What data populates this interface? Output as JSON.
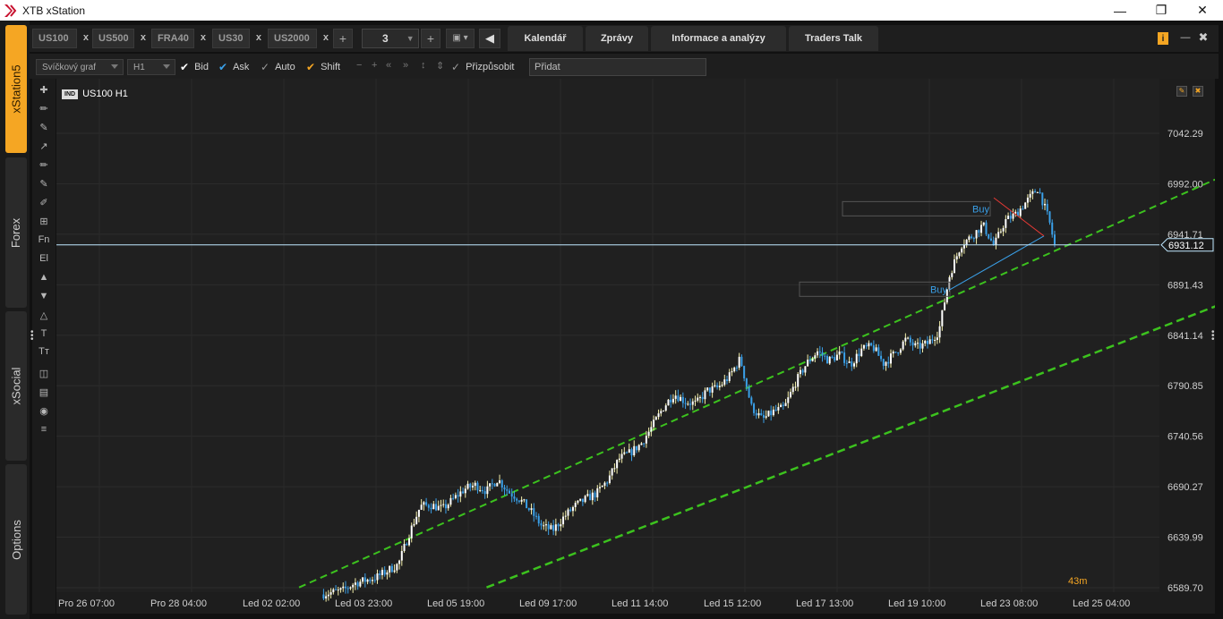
{
  "window": {
    "title": "XTB xStation"
  },
  "side_tabs": [
    "xStation5",
    "Forex",
    "xSocial",
    "Options"
  ],
  "instrument_tabs": [
    "US100",
    "US500",
    "FRA40",
    "US30",
    "US2000"
  ],
  "close_glyph": "x",
  "layout_count": "3",
  "nav_tabs": [
    "Kalendář",
    "Zprávy",
    "Informace a analýzy",
    "Traders Talk"
  ],
  "toolbar": {
    "chart_type": "Svíčkový graf",
    "timeframe": "H1",
    "checks": [
      {
        "label": "Bid",
        "checked": true,
        "color": "#ffffff"
      },
      {
        "label": "Ask",
        "checked": true,
        "color": "#3aa0e8"
      },
      {
        "label": "Auto",
        "checked": false,
        "color": "#9a9a9a"
      },
      {
        "label": "Shift",
        "checked": true,
        "color": "#f5a623"
      }
    ],
    "fit_label": "Přizpůsobit",
    "add_value": "Přidat"
  },
  "draw_tools": [
    "plus-icon",
    "ruler-icon",
    "ruler-alt-icon",
    "trendline-icon",
    "pencil-icon",
    "pencil-alt-icon",
    "brush-icon",
    "fork-icon",
    "Fn",
    "El",
    "up-arrow-icon",
    "down-arrow-icon",
    "shapes-icon",
    "T",
    "Tт",
    "layers-icon",
    "bars-icon",
    "camera-icon",
    "list-icon"
  ],
  "chart": {
    "badge": "IND",
    "symbol": "US100 H1",
    "timer": "43m",
    "current_price": "6931.12",
    "colors": {
      "up": "#ffffff",
      "down": "#3aa0e8",
      "wick_up": "#f3efaa",
      "channel": "#3cc21e",
      "price_line": "#bfe8ff",
      "order_line": "#3aa0e8",
      "sl_line": "#e53935"
    },
    "orders": [
      {
        "label": "Buy",
        "price": 6960
      },
      {
        "label": "Buy",
        "price": 6887
      }
    ]
  },
  "chart_data": {
    "type": "candlestick",
    "title": "US100 H1",
    "ylim": [
      6575,
      7060
    ],
    "y_ticks": [
      "7042.29",
      "6992.00",
      "6941.71",
      "6891.43",
      "6841.14",
      "6790.85",
      "6740.56",
      "6690.27",
      "6639.99",
      "6589.70"
    ],
    "x_ticks": [
      "Pro 26 07:00",
      "Pro 28 04:00",
      "Led 02 02:00",
      "Led 03 23:00",
      "Led 05 19:00",
      "Led 09 17:00",
      "Led 11 14:00",
      "Led 15 12:00",
      "Led 17 13:00",
      "Led 19 10:00",
      "Led 23 08:00",
      "Led 25 04:00"
    ],
    "channel_upper": [
      [
        6590,
        0.22
      ],
      [
        7040,
        1.14
      ]
    ],
    "channel_lower": [
      [
        6590,
        0.39
      ],
      [
        6912,
        1.15
      ]
    ],
    "close_path": [
      [
        0.24,
        6583
      ],
      [
        0.26,
        6587
      ],
      [
        0.27,
        6594
      ],
      [
        0.29,
        6600
      ],
      [
        0.31,
        6613
      ],
      [
        0.32,
        6644
      ],
      [
        0.33,
        6671
      ],
      [
        0.34,
        6672
      ],
      [
        0.35,
        6668
      ],
      [
        0.36,
        6678
      ],
      [
        0.37,
        6688
      ],
      [
        0.38,
        6692
      ],
      [
        0.39,
        6686
      ],
      [
        0.4,
        6698
      ],
      [
        0.41,
        6685
      ],
      [
        0.42,
        6678
      ],
      [
        0.43,
        6666
      ],
      [
        0.44,
        6651
      ],
      [
        0.45,
        6647
      ],
      [
        0.46,
        6660
      ],
      [
        0.47,
        6671
      ],
      [
        0.48,
        6678
      ],
      [
        0.49,
        6684
      ],
      [
        0.5,
        6697
      ],
      [
        0.51,
        6718
      ],
      [
        0.52,
        6724
      ],
      [
        0.53,
        6733
      ],
      [
        0.54,
        6750
      ],
      [
        0.55,
        6769
      ],
      [
        0.56,
        6783
      ],
      [
        0.57,
        6775
      ],
      [
        0.58,
        6773
      ],
      [
        0.59,
        6786
      ],
      [
        0.6,
        6789
      ],
      [
        0.61,
        6800
      ],
      [
        0.62,
        6818
      ],
      [
        0.63,
        6770
      ],
      [
        0.64,
        6757
      ],
      [
        0.65,
        6765
      ],
      [
        0.66,
        6769
      ],
      [
        0.67,
        6794
      ],
      [
        0.68,
        6813
      ],
      [
        0.69,
        6825
      ],
      [
        0.7,
        6816
      ],
      [
        0.71,
        6822
      ],
      [
        0.72,
        6812
      ],
      [
        0.73,
        6827
      ],
      [
        0.74,
        6830
      ],
      [
        0.75,
        6813
      ],
      [
        0.76,
        6823
      ],
      [
        0.77,
        6837
      ],
      [
        0.78,
        6829
      ],
      [
        0.79,
        6833
      ],
      [
        0.8,
        6845
      ],
      [
        0.81,
        6902
      ],
      [
        0.82,
        6931
      ],
      [
        0.83,
        6940
      ],
      [
        0.84,
        6951
      ],
      [
        0.85,
        6930
      ],
      [
        0.86,
        6955
      ],
      [
        0.87,
        6962
      ],
      [
        0.88,
        6975
      ],
      [
        0.89,
        6988
      ],
      [
        0.9,
        6955
      ],
      [
        0.905,
        6931
      ]
    ]
  }
}
